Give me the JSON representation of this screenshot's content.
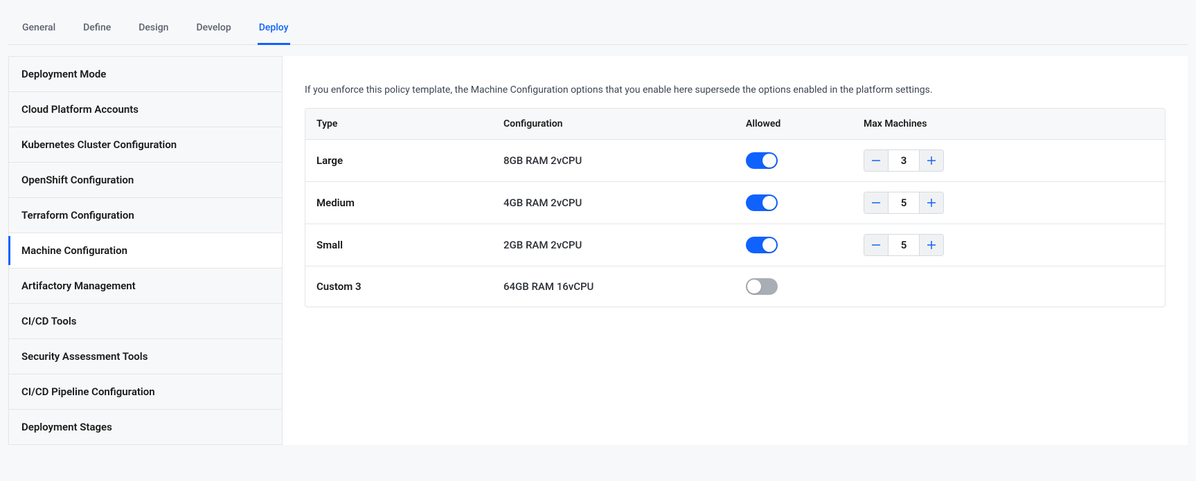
{
  "tabs": [
    {
      "label": "General",
      "active": false
    },
    {
      "label": "Define",
      "active": false
    },
    {
      "label": "Design",
      "active": false
    },
    {
      "label": "Develop",
      "active": false
    },
    {
      "label": "Deploy",
      "active": true
    }
  ],
  "sidebar": {
    "items": [
      {
        "label": "Deployment Mode",
        "selected": false
      },
      {
        "label": "Cloud Platform Accounts",
        "selected": false
      },
      {
        "label": "Kubernetes Cluster Configuration",
        "selected": false
      },
      {
        "label": "OpenShift Configuration",
        "selected": false
      },
      {
        "label": "Terraform Configuration",
        "selected": false
      },
      {
        "label": "Machine Configuration",
        "selected": true
      },
      {
        "label": "Artifactory Management",
        "selected": false
      },
      {
        "label": "CI/CD Tools",
        "selected": false
      },
      {
        "label": "Security Assessment Tools",
        "selected": false
      },
      {
        "label": "CI/CD Pipeline Configuration",
        "selected": false
      },
      {
        "label": "Deployment Stages",
        "selected": false
      }
    ]
  },
  "content": {
    "description": "If you enforce this policy template, the Machine Configuration options that you enable here supersede the options enabled in the platform settings.",
    "columns": {
      "type": "Type",
      "configuration": "Configuration",
      "allowed": "Allowed",
      "max_machines": "Max Machines"
    },
    "rows": [
      {
        "type": "Large",
        "configuration": "8GB RAM 2vCPU",
        "allowed": true,
        "max": "3"
      },
      {
        "type": "Medium",
        "configuration": "4GB RAM 2vCPU",
        "allowed": true,
        "max": "5"
      },
      {
        "type": "Small",
        "configuration": "2GB RAM 2vCPU",
        "allowed": true,
        "max": "5"
      },
      {
        "type": "Custom 3",
        "configuration": "64GB RAM 16vCPU",
        "allowed": false,
        "max": ""
      }
    ]
  },
  "colors": {
    "accent": "#1062fe",
    "toggle_off": "#a9adb5"
  }
}
